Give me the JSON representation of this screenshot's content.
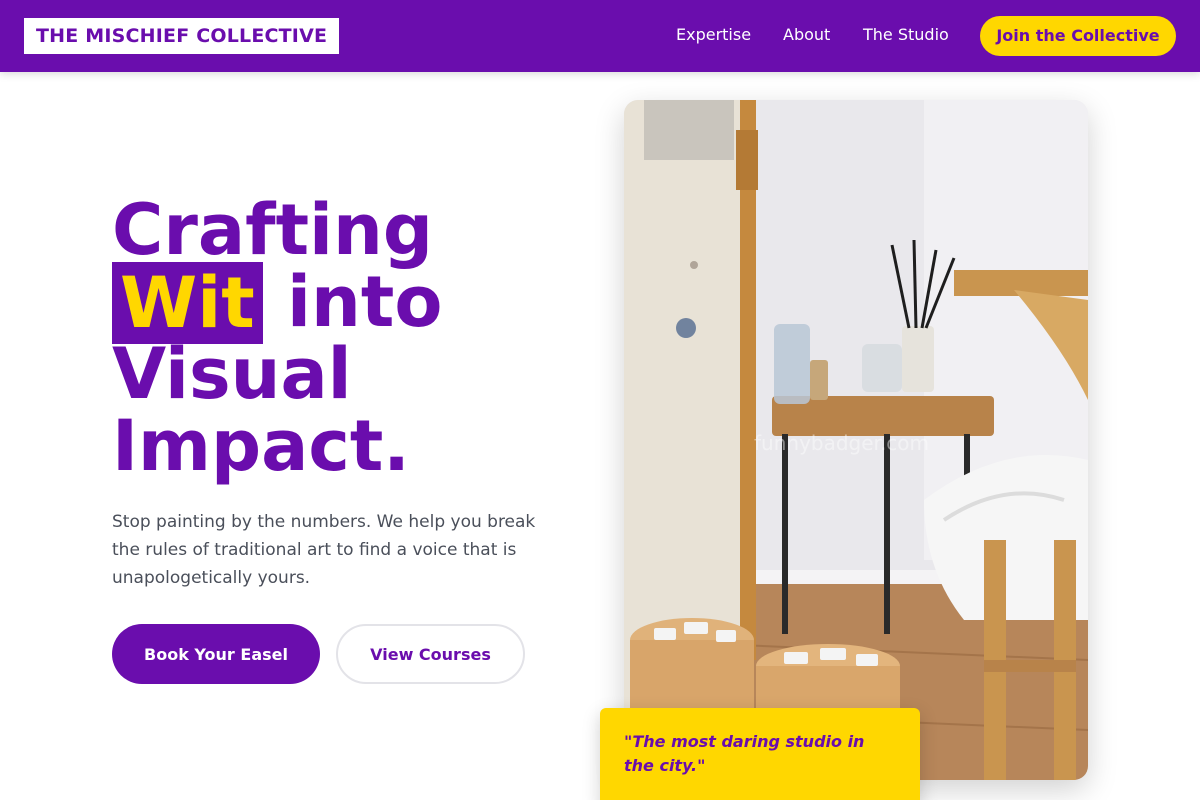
{
  "nav": {
    "logo": "THE MISCHIEF COLLECTIVE",
    "links": [
      "Expertise",
      "About",
      "The Studio"
    ],
    "cta": "Join the Collective"
  },
  "hero": {
    "headline": {
      "line1": "Crafting",
      "highlight": "Wit",
      "line2_rest": " into",
      "line3": "Visual",
      "line4": "Impact."
    },
    "subtext": "Stop painting by the numbers. We help you break the rules of traditional art to find a voice that is unapologetically yours.",
    "primary_button": "Book Your Easel",
    "secondary_button": "View Courses"
  },
  "image": {
    "description_icon": "art-studio-photo",
    "watermark": "funnybadger.com"
  },
  "quote": "\"The most daring studio in the city.\"",
  "colors": {
    "brand_purple": "#6a0dad",
    "accent_yellow": "#ffd700",
    "body_text": "#4a4f5a"
  }
}
